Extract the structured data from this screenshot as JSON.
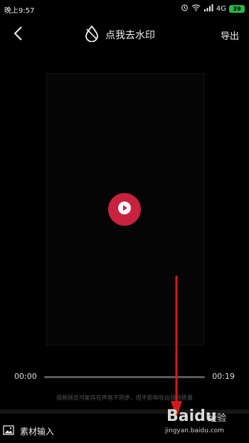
{
  "status_bar": {
    "time": "晚上9:57",
    "network": "4G",
    "battery": "39",
    "icons": [
      "alarm-icon",
      "wifi-icon",
      "signal-icon",
      "battery-icon"
    ]
  },
  "header": {
    "back_icon": "chevron-left-icon",
    "watermark_label": "点我去水印",
    "watermark_icon": "water-drop-icon",
    "export_label": "导出"
  },
  "player": {
    "play_icon": "play-icon",
    "accent_color": "#c8223f",
    "current_time": "00:00",
    "total_time": "00:19",
    "progress": 0
  },
  "hint": "视频预览可能存在声音不同步，但不影响导出视频质量",
  "bottom_bar": {
    "material_label": "素材输入",
    "material_icon": "image-icon"
  },
  "watermark": {
    "logo": "Baidu",
    "logo_suffix": "经验",
    "url": "jingyan.baidu.com"
  }
}
